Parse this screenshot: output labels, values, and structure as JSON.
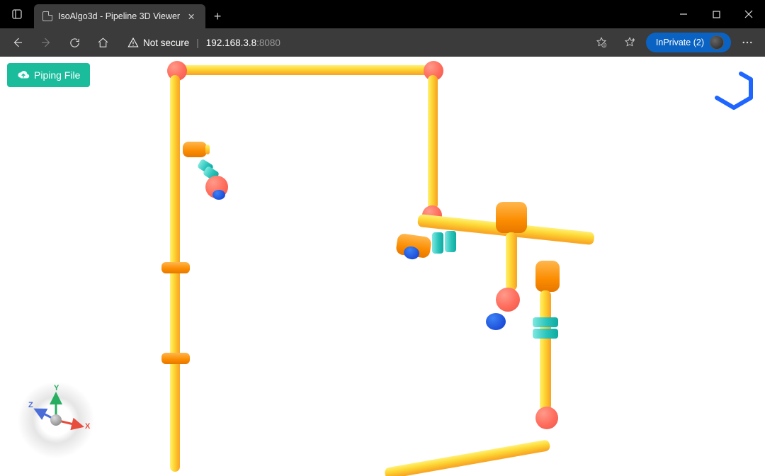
{
  "browser": {
    "tab_title": "IsoAlgo3d - Pipeline 3D Viewer",
    "security_label": "Not secure",
    "host": "192.168.3.8",
    "port": ":8080",
    "inprivate_label": "InPrivate (2)"
  },
  "app": {
    "upload_button_label": "Piping File"
  },
  "gizmo": {
    "x": "X",
    "y": "Y",
    "z": "Z"
  },
  "colors": {
    "accent_button": "#1abc9c",
    "logo": "#1e66ff",
    "pipe_yellow": "#fdd835",
    "elbow_red": "#ff6b5b",
    "fitting_orange": "#fb8c00",
    "flange_cyan": "#29c4bb",
    "cap_blue": "#1d4ed8"
  }
}
